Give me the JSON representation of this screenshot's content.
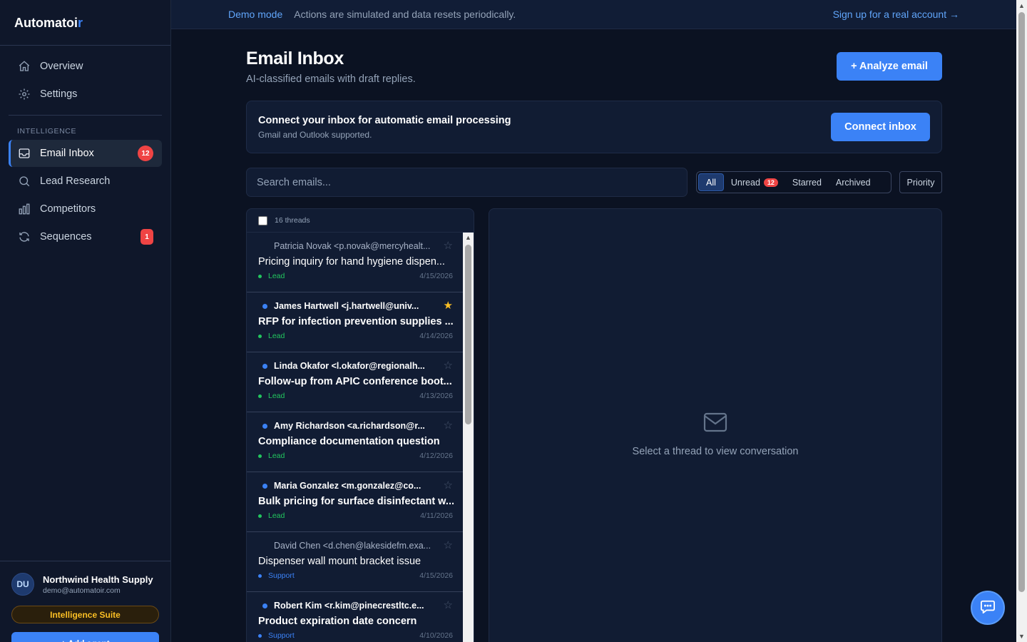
{
  "brand": {
    "name_main": "Automatoi",
    "name_accent": "r"
  },
  "sidebar": {
    "top_items": [
      {
        "label": "Overview",
        "icon": "home-icon"
      },
      {
        "label": "Settings",
        "icon": "gear-icon"
      }
    ],
    "section_label": "INTELLIGENCE",
    "items": [
      {
        "label": "Email Inbox",
        "icon": "inbox-icon",
        "badge": "12",
        "active": true
      },
      {
        "label": "Lead Research",
        "icon": "search-icon"
      },
      {
        "label": "Competitors",
        "icon": "bar-chart-icon"
      },
      {
        "label": "Sequences",
        "icon": "refresh-icon",
        "badge": "1"
      }
    ],
    "footer": {
      "avatar": "DU",
      "org_name": "Northwind Health Supply",
      "email": "demo@automatoir.com",
      "suite": "Intelligence Suite",
      "add_agent": "+ Add agent"
    }
  },
  "banner": {
    "mode": "Demo mode",
    "message": "Actions are simulated and data resets periodically.",
    "signup": "Sign up for a real account →"
  },
  "header": {
    "title": "Email Inbox",
    "subtitle": "AI-classified emails with draft replies.",
    "analyze_button": "+ Analyze email"
  },
  "connect": {
    "title": "Connect your inbox for automatic email processing",
    "subtitle": "Gmail and Outlook supported.",
    "button": "Connect inbox"
  },
  "search": {
    "placeholder": "Search emails..."
  },
  "filters": {
    "all": "All",
    "unread": "Unread",
    "unread_count": "12",
    "starred": "Starred",
    "archived": "Archived",
    "priority": "Priority"
  },
  "threads": {
    "count_label": "16 threads",
    "items": [
      {
        "from": "Patricia Novak <p.novak@mercyhealt...",
        "subject": "Pricing inquiry for hand hygiene dispen...",
        "tag": "Lead",
        "date": "4/15/2026",
        "unread": false,
        "starred": false
      },
      {
        "from": "James Hartwell <j.hartwell@univ...",
        "subject": "RFP for infection prevention supplies ...",
        "tag": "Lead",
        "date": "4/14/2026",
        "unread": true,
        "starred": true
      },
      {
        "from": "Linda Okafor <l.okafor@regionalh...",
        "subject": "Follow-up from APIC conference boot...",
        "tag": "Lead",
        "date": "4/13/2026",
        "unread": true,
        "starred": false
      },
      {
        "from": "Amy Richardson <a.richardson@r...",
        "subject": "Compliance documentation question",
        "tag": "Lead",
        "date": "4/12/2026",
        "unread": true,
        "starred": false
      },
      {
        "from": "Maria Gonzalez <m.gonzalez@co...",
        "subject": "Bulk pricing for surface disinfectant w...",
        "tag": "Lead",
        "date": "4/11/2026",
        "unread": true,
        "starred": false
      },
      {
        "from": "David Chen <d.chen@lakesidefm.exa...",
        "subject": "Dispenser wall mount bracket issue",
        "tag": "Support",
        "date": "4/15/2026",
        "unread": false,
        "starred": false
      },
      {
        "from": "Robert Kim <r.kim@pinecrestltc.e...",
        "subject": "Product expiration date concern",
        "tag": "Support",
        "date": "4/10/2026",
        "unread": true,
        "starred": false
      }
    ]
  },
  "detail": {
    "empty_text": "Select a thread to view conversation"
  },
  "colors": {
    "accent": "#3b82f6",
    "lead": "#22c55e",
    "support": "#3b82f6",
    "badge": "#ef4444",
    "star": "#fbbf24"
  }
}
